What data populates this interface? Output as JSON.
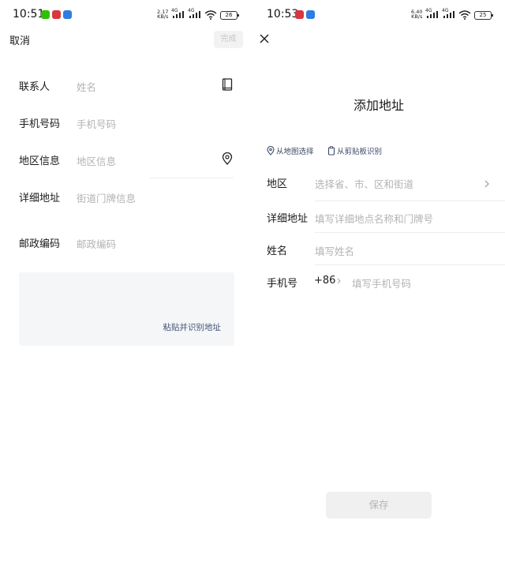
{
  "left": {
    "status": {
      "time": "10:51",
      "net_speed_top": "2.17",
      "net_speed_unit": "KB/s",
      "battery": "26"
    },
    "header": {
      "cancel_label": "取消",
      "done_label": "完成"
    },
    "form": {
      "contact_label": "联系人",
      "contact_placeholder": "姓名",
      "phone_label": "手机号码",
      "phone_placeholder": "手机号码",
      "region_label": "地区信息",
      "region_placeholder": "地区信息",
      "detail_label": "详细地址",
      "detail_placeholder": "街道门牌信息",
      "zip_label": "邮政编码",
      "zip_placeholder": "邮政编码"
    },
    "paste": {
      "label": "粘贴并识别地址"
    }
  },
  "right": {
    "status": {
      "time": "10:53",
      "net_speed_top": "6.40",
      "net_speed_unit": "KB/s",
      "battery": "25"
    },
    "title": "添加地址",
    "sources": {
      "map_label": "从地图选择",
      "clipboard_label": "从剪贴板识别"
    },
    "form": {
      "region_label": "地区",
      "region_placeholder": "选择省、市、区和街道",
      "detail_label": "详细地址",
      "detail_placeholder": "填写详细地点名称和门牌号",
      "name_label": "姓名",
      "name_placeholder": "填写姓名",
      "phone_label": "手机号",
      "country_code": "+86",
      "phone_placeholder": "填写手机号码"
    },
    "save_label": "保存"
  },
  "colors": {
    "placeholder": "#b3b3b3",
    "link": "#445577",
    "wechat": "#2dc100",
    "red_app": "#d9363e",
    "blue_app": "#2f7de1"
  },
  "icons": [
    "address-book-icon",
    "location-pin-icon",
    "close-icon",
    "chevron-right-icon",
    "clipboard-icon",
    "wifi-icon",
    "signal-icon",
    "battery-icon"
  ]
}
